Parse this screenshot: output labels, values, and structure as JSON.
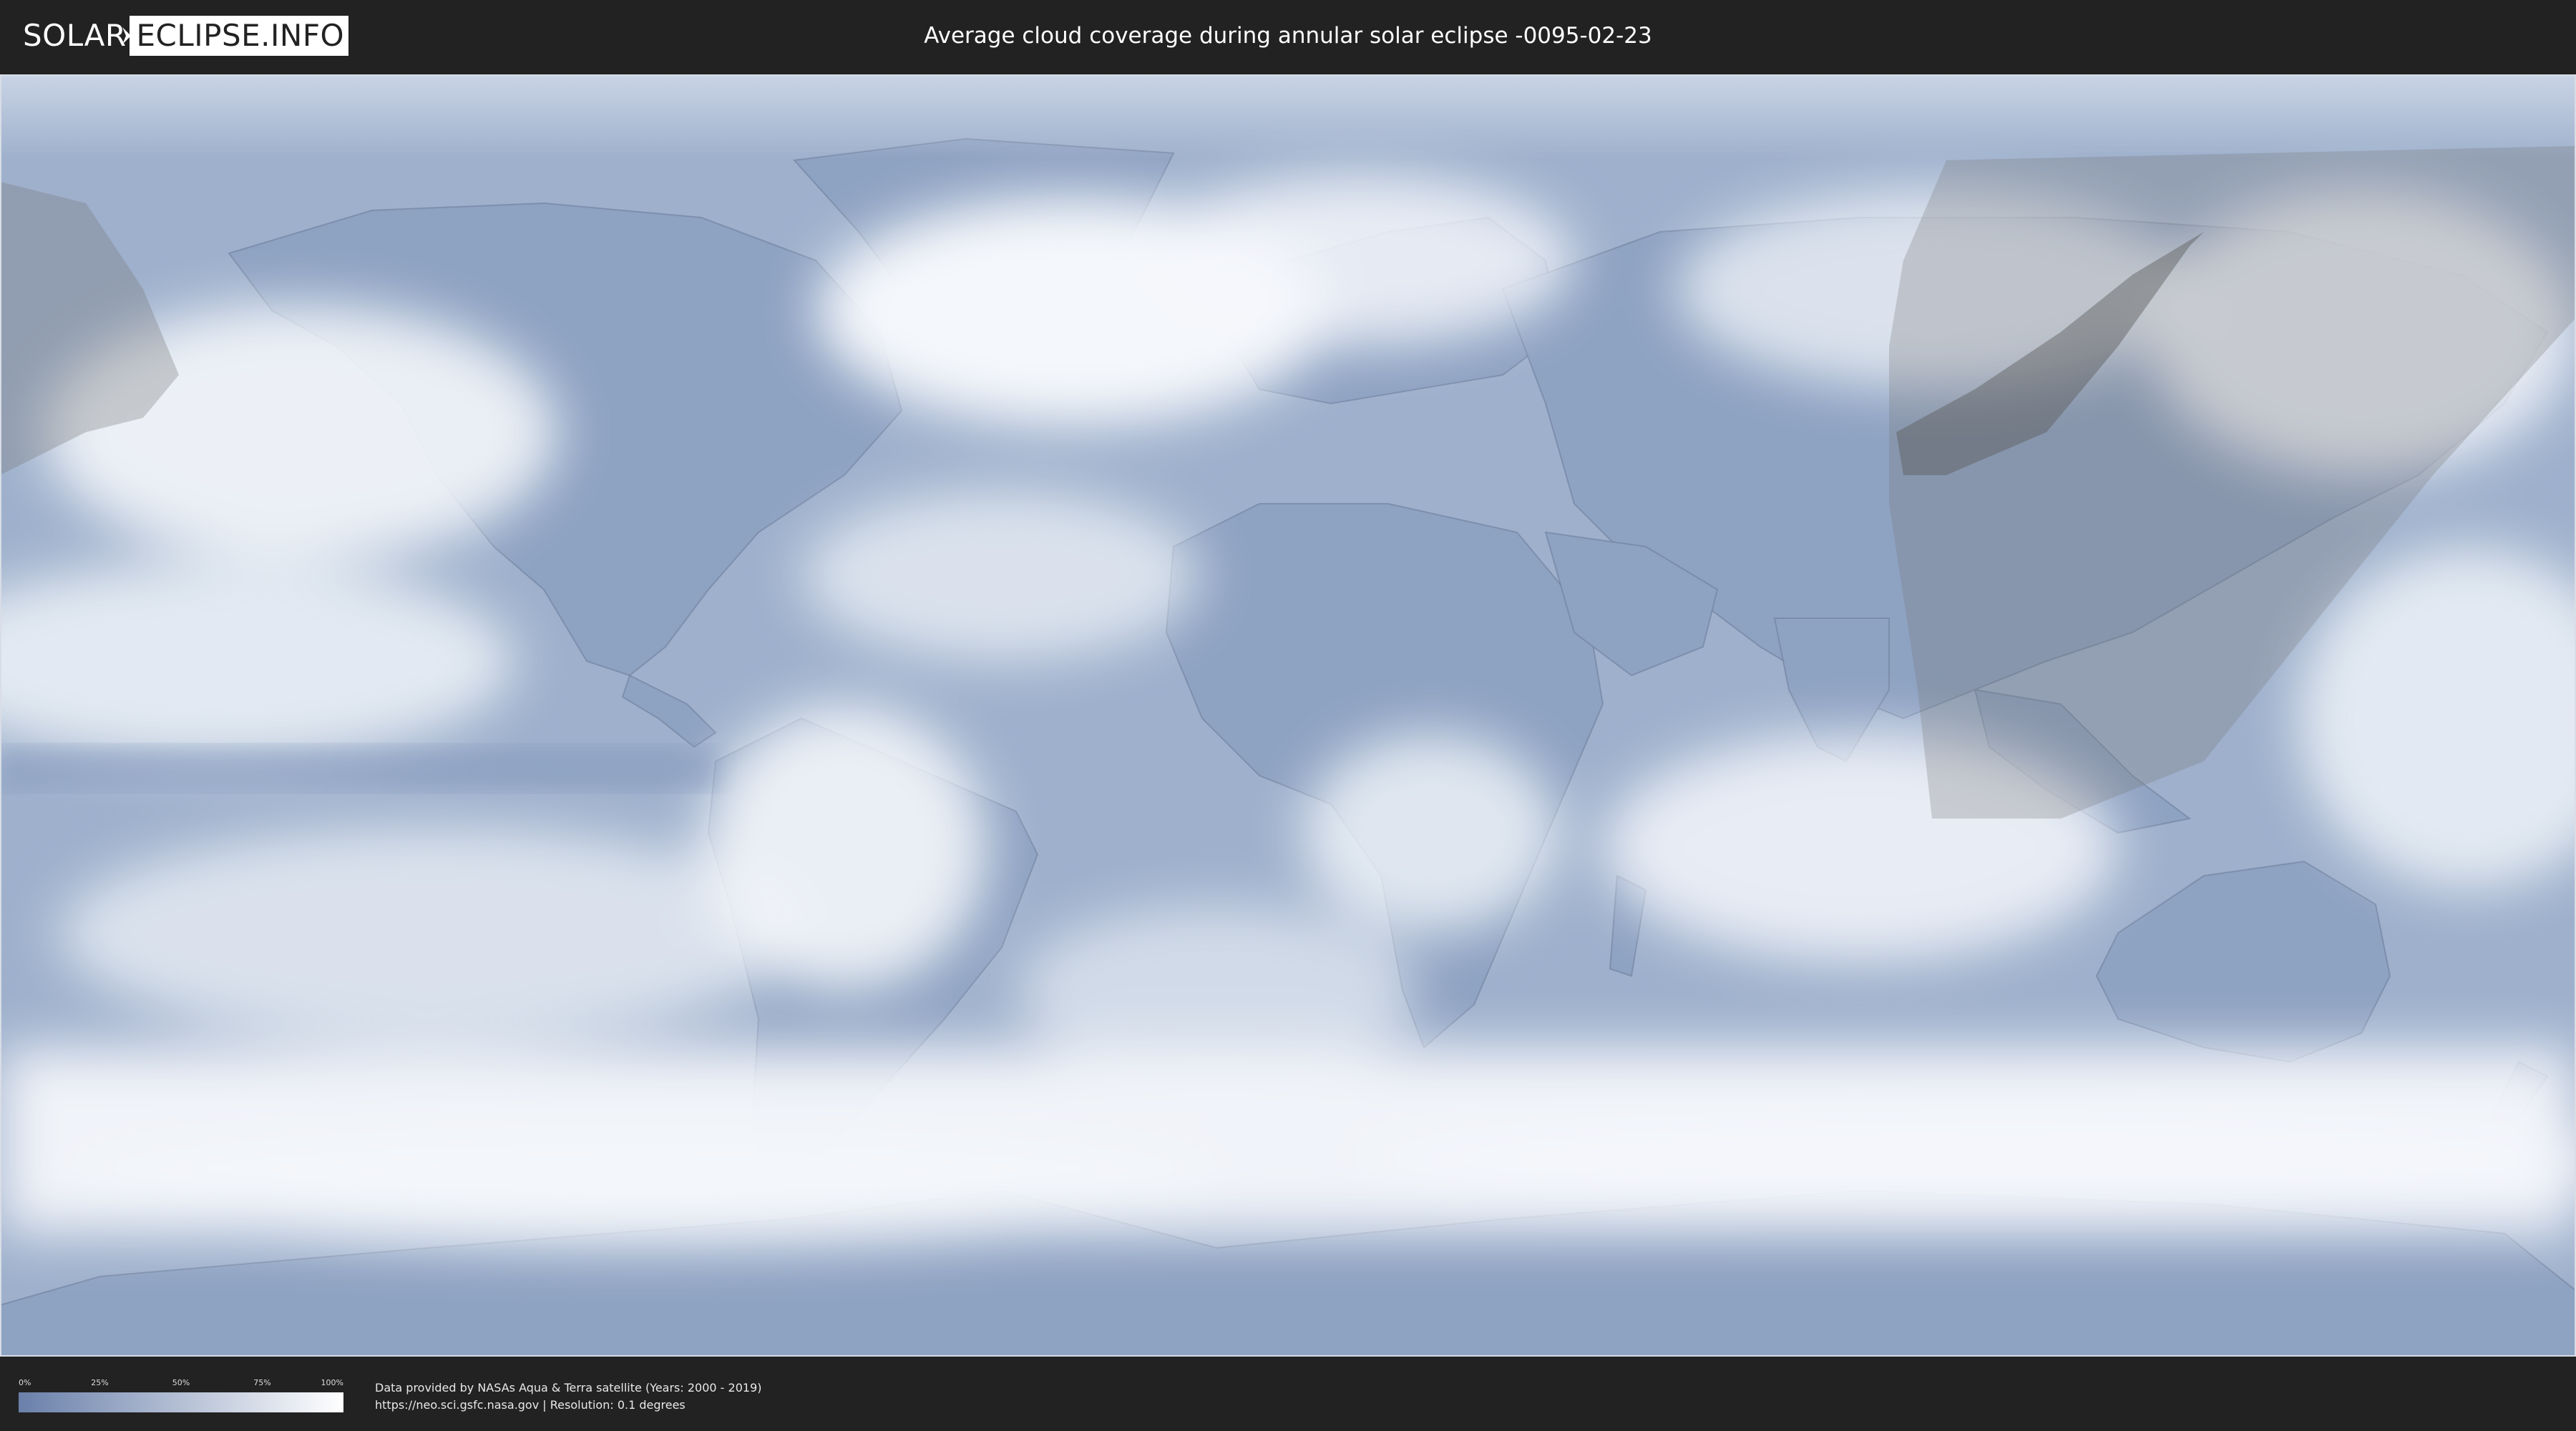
{
  "header": {
    "logo_left": "SOLAR",
    "logo_right": "ECLIPSE.INFO",
    "title": "Average cloud coverage during annular solar eclipse -0095-02-23"
  },
  "map": {
    "ocean_color": "#9eb0cc",
    "land_color": "#8ea2c2",
    "cloud_color": "#f4f7fb",
    "eclipse_path_color": "#777777"
  },
  "legend": {
    "ticks": [
      "0%",
      "25%",
      "50%",
      "75%",
      "100%"
    ],
    "gradient_from": "#6a80aa",
    "gradient_to": "#ffffff"
  },
  "footer": {
    "credit_line1": "Data provided by NASAs Aqua & Terra satellite (Years: 2000 - 2019)",
    "credit_line2": "https://neo.sci.gsfc.nasa.gov | Resolution: 0.1 degrees"
  }
}
